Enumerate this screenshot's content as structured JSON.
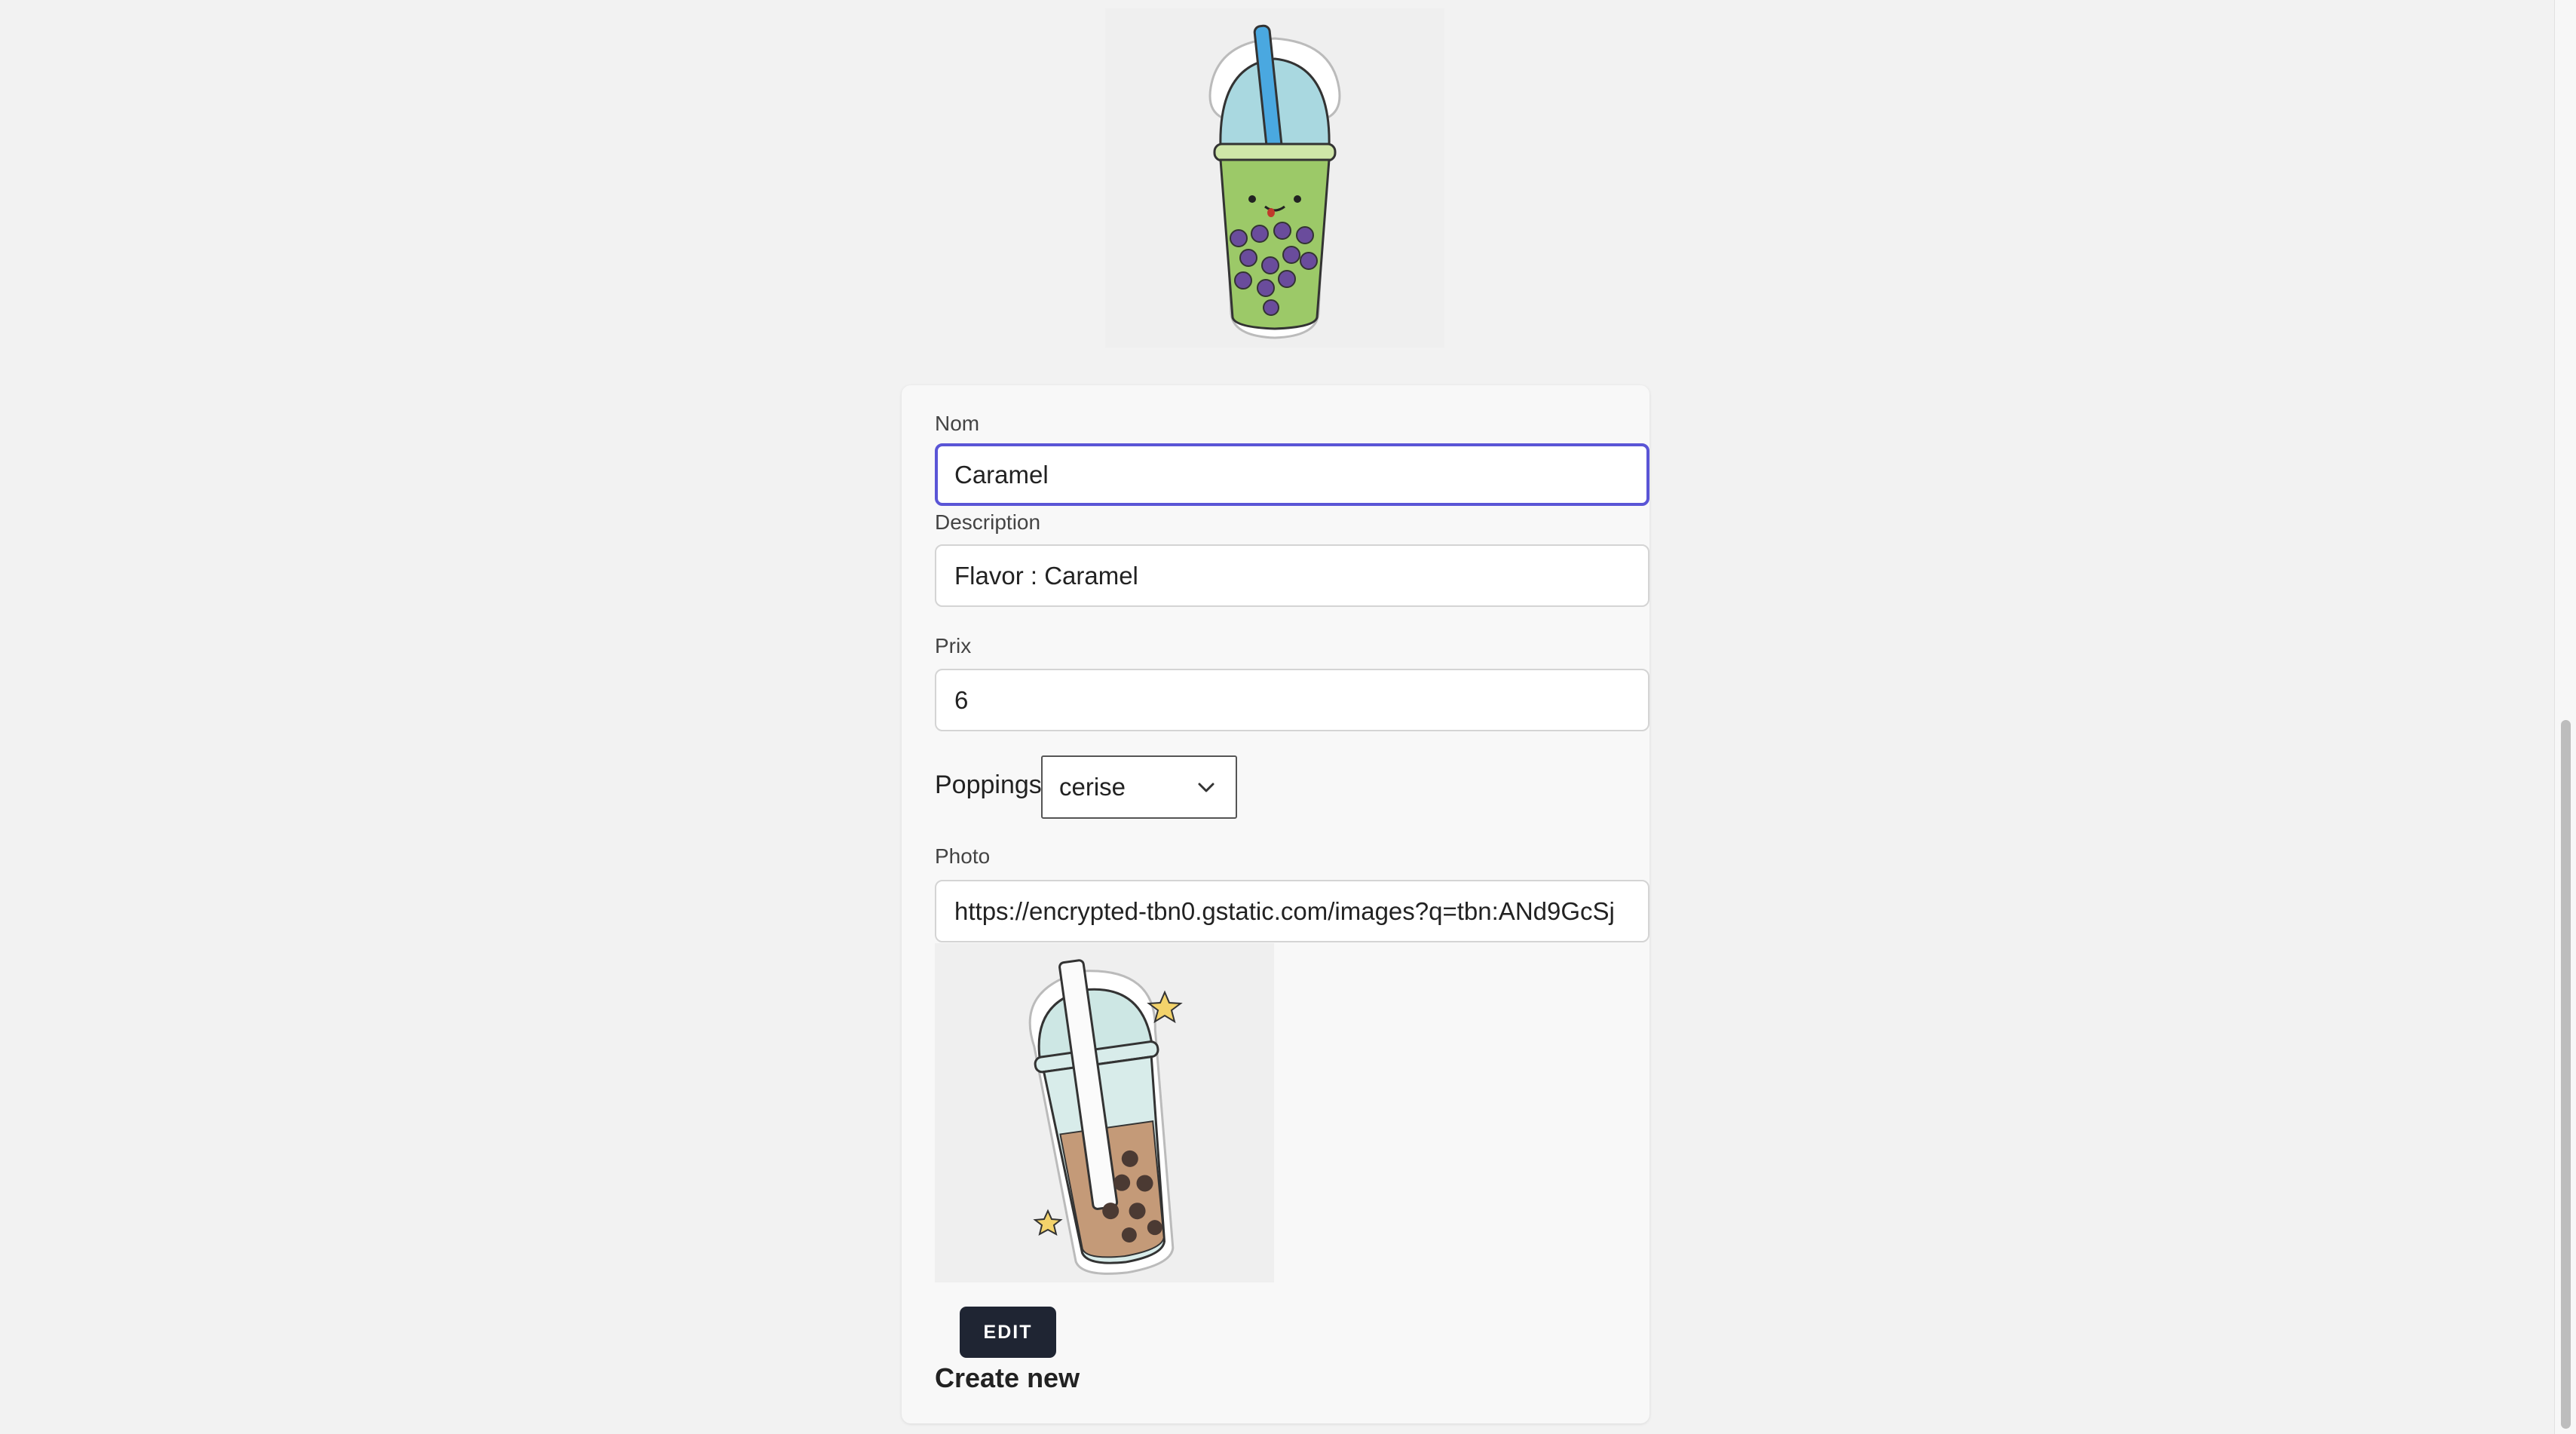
{
  "header_image": {
    "icon": "bubble-tea-green-icon"
  },
  "form": {
    "nom": {
      "label": "Nom",
      "value": "Caramel"
    },
    "description": {
      "label": "Description",
      "value": "Flavor : Caramel"
    },
    "prix": {
      "label": "Prix",
      "value": "6"
    },
    "poppings": {
      "label": "Poppings",
      "selected": "cerise"
    },
    "photo": {
      "label": "Photo",
      "value": "https://encrypted-tbn0.gstatic.com/images?q=tbn:ANd9GcSj"
    },
    "preview": {
      "icon": "bubble-tea-brown-icon"
    },
    "edit_label": "EDIT",
    "create_new_label": "Create new"
  },
  "colors": {
    "focus": "#5a55d6",
    "button": "#1f2533"
  }
}
